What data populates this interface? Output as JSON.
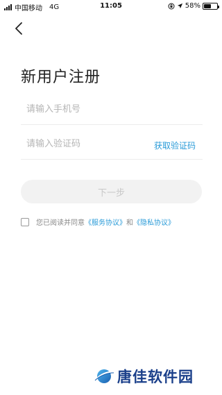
{
  "status_bar": {
    "carrier": "中国移动",
    "network": "4G",
    "time": "11:05",
    "battery_percent": "58%",
    "battery_level": 0.58
  },
  "nav": {
    "back_icon": "chevron-left-icon"
  },
  "page": {
    "title": "新用户注册"
  },
  "form": {
    "phone_placeholder": "请输入手机号",
    "code_placeholder": "请输入验证码",
    "get_code_label": "获取验证码",
    "next_label": "下一步",
    "next_enabled": false
  },
  "agreement": {
    "checked": false,
    "prefix": "您已阅读并同意",
    "service_link": "《服务协议》",
    "conjunction": "和",
    "privacy_link": "《隐私协议》"
  },
  "watermark": {
    "text": "唐佳软件园"
  },
  "colors": {
    "accent": "#2a9bd8",
    "button_bg": "#f2f2f2",
    "button_text": "#c8c8c8",
    "watermark": "#1a3f8a"
  }
}
